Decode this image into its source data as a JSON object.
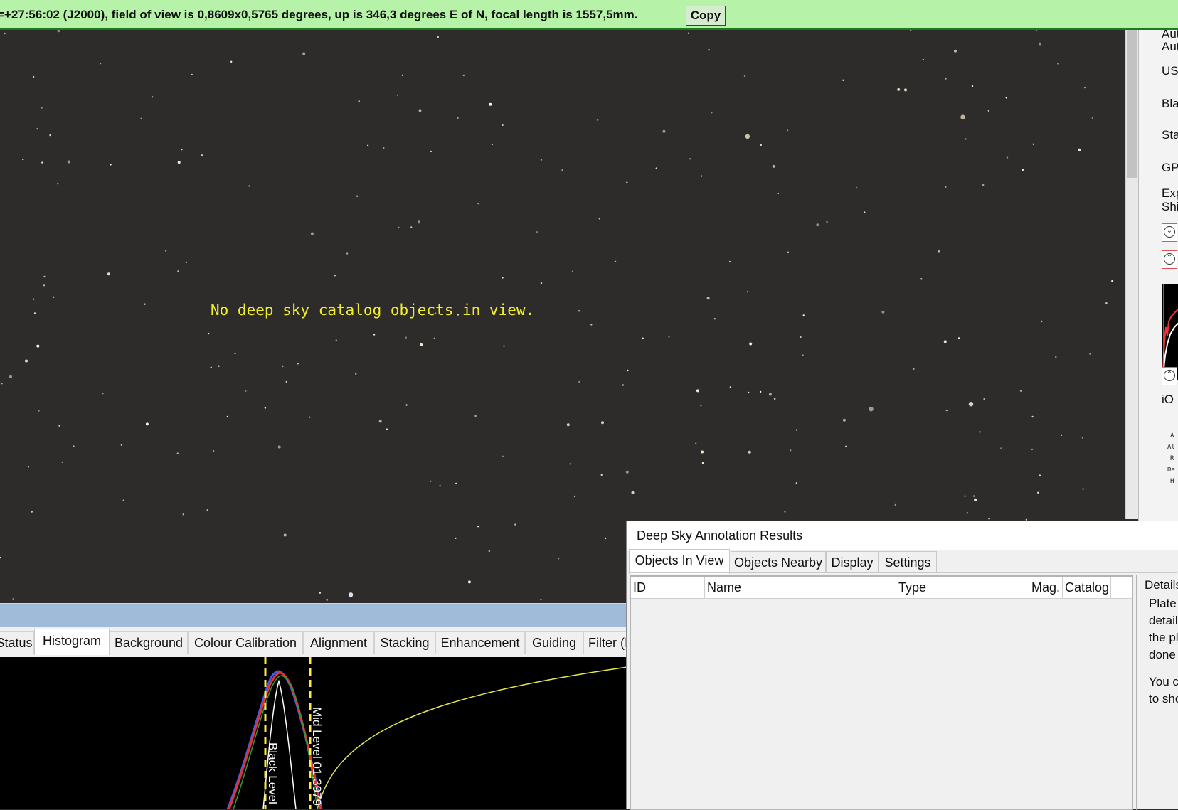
{
  "banner": {
    "text": "=+27:56:02 (J2000), field of view is 0,8609x0,5765 degrees, up is 346,3 degrees E of N, focal length is 1557,5mm.",
    "copy_label": "Copy"
  },
  "sky": {
    "annotation": "No deep sky catalog objects in view."
  },
  "right_panel": {
    "labels": [
      "Aut",
      "Aut",
      "US",
      "Bla",
      "Sta",
      "GP",
      "Exp",
      "Shi",
      "iO"
    ],
    "tiny_labels": [
      "A",
      "Al",
      "R",
      "De",
      "H"
    ]
  },
  "bottom_tabs": [
    {
      "label": "Status"
    },
    {
      "label": "Histogram",
      "active": true
    },
    {
      "label": "Background"
    },
    {
      "label": "Colour Calibration"
    },
    {
      "label": "Alignment"
    },
    {
      "label": "Stacking"
    },
    {
      "label": "Enhancement"
    },
    {
      "label": "Guiding"
    },
    {
      "label": "Filter (I"
    }
  ],
  "histogram": {
    "black_level_label": "Black Level",
    "mid_level_label": "Mid Level 01,3979"
  },
  "dialog": {
    "title": "Deep Sky Annotation Results",
    "tabs": [
      {
        "label": "Objects In View",
        "active": true
      },
      {
        "label": "Objects Nearby"
      },
      {
        "label": "Display"
      },
      {
        "label": "Settings"
      }
    ],
    "columns": [
      "ID",
      "Name",
      "Type",
      "Mag.",
      "Catalog"
    ],
    "rows": [],
    "details": {
      "legend": "Details",
      "lines": [
        "Plate s",
        "details",
        "the pla",
        "done s",
        "You ca",
        "to sho"
      ]
    }
  },
  "colors": {
    "banner_bg": "#b6f2a8",
    "sky_bg": "#2d2c2a",
    "annotation": "#f2ee2a",
    "separator": "#9fbbd9"
  }
}
